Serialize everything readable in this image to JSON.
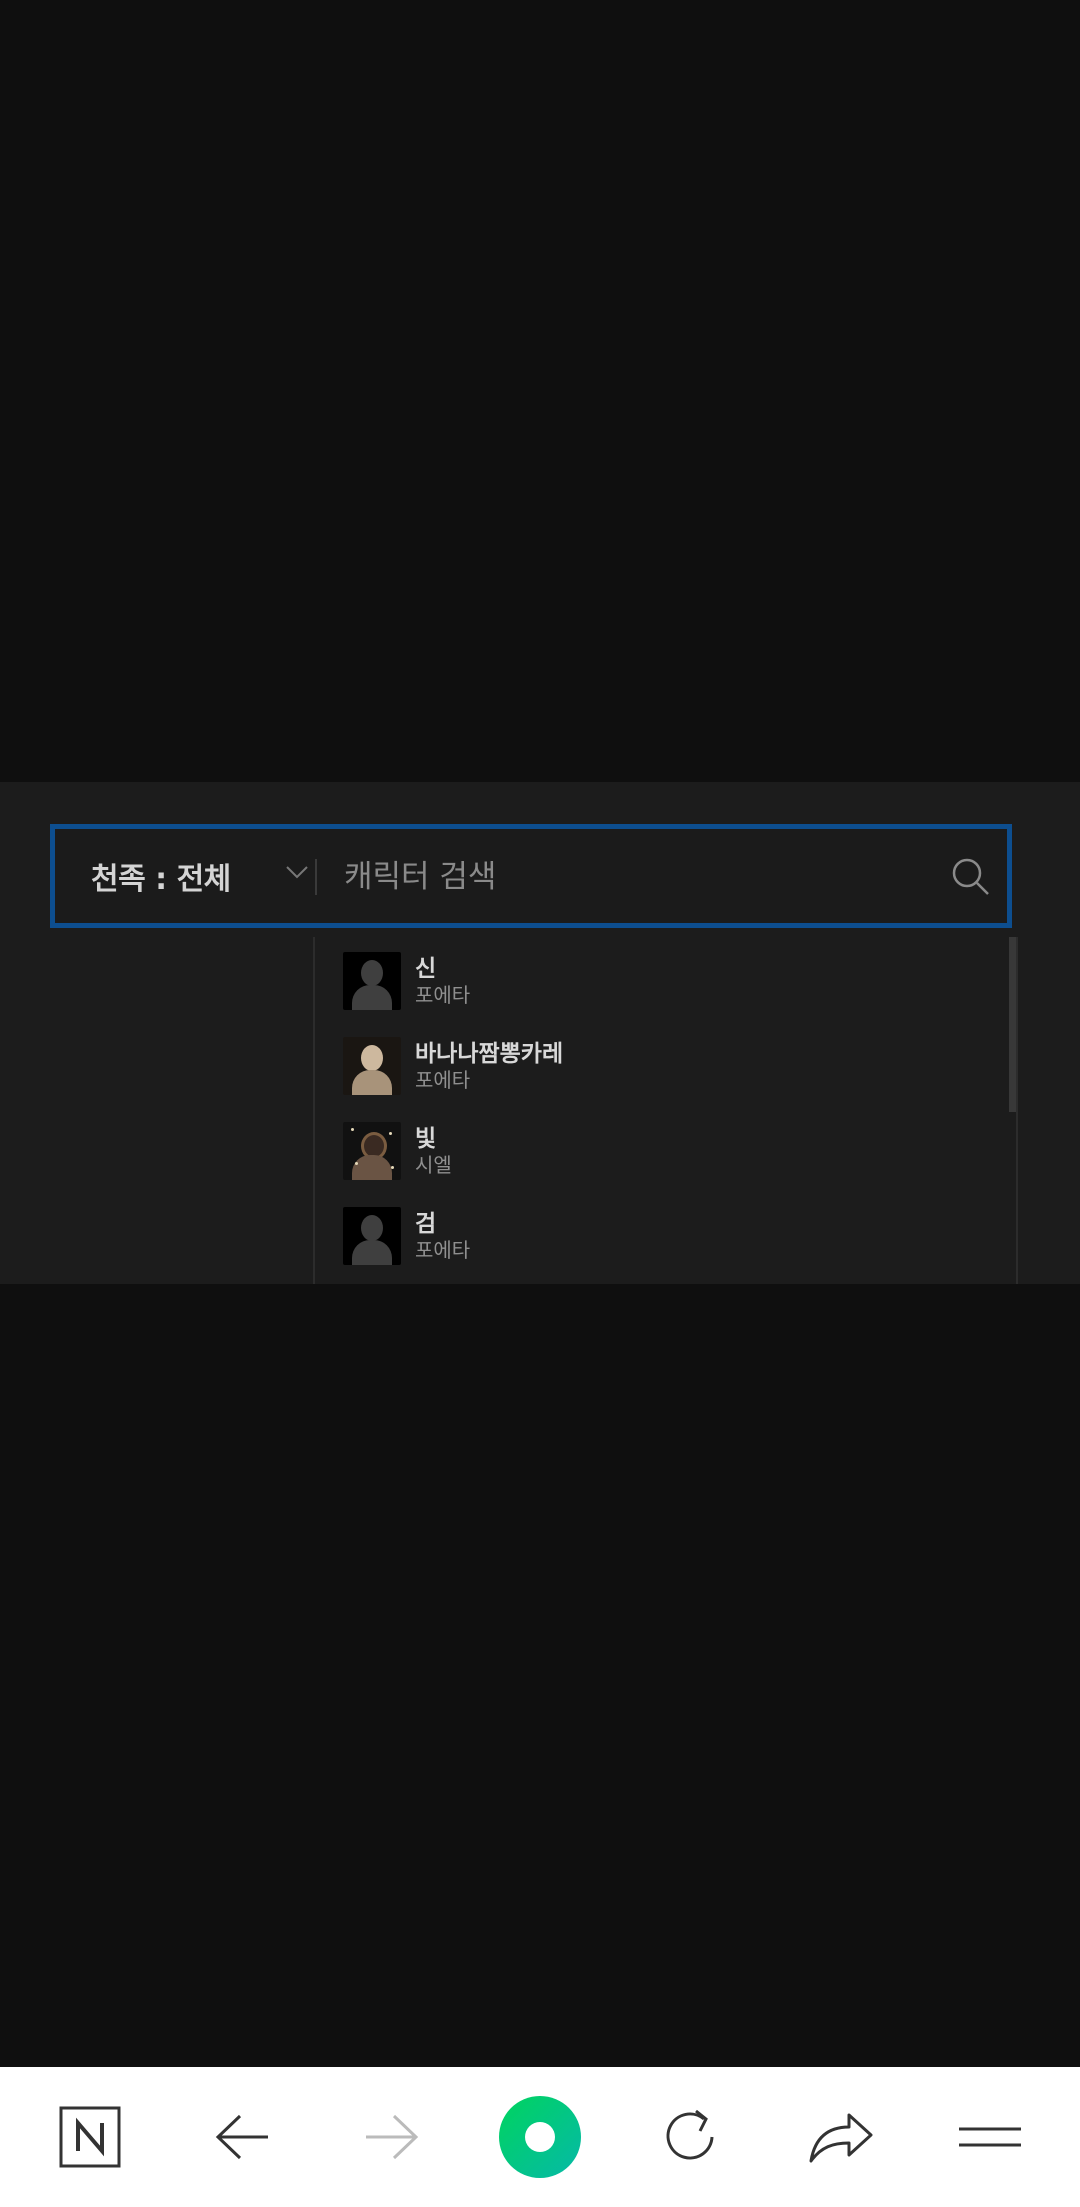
{
  "filter": {
    "label": "천족 : 전체"
  },
  "search": {
    "placeholder": "캐릭터 검색"
  },
  "results": [
    {
      "name": "신",
      "server": "포에타",
      "avatar": "silhouette-avatar"
    },
    {
      "name": "바나나짬뽕카레",
      "server": "포에타",
      "avatar": "sculpture-avatar"
    },
    {
      "name": "빛",
      "server": "시엘",
      "avatar": "character-art-avatar"
    },
    {
      "name": "검",
      "server": "포에타",
      "avatar": "silhouette-avatar"
    }
  ],
  "browser_nav": {
    "buttons": [
      "naver-home-icon",
      "back-icon",
      "forward-icon",
      "green-dot-icon",
      "reload-icon",
      "share-icon",
      "menu-icon"
    ]
  },
  "colors": {
    "accent_border": "#0d4e8f",
    "panel_bg": "#1c1c1c",
    "page_bg": "#0f0f0f",
    "green": "#03c75a"
  }
}
